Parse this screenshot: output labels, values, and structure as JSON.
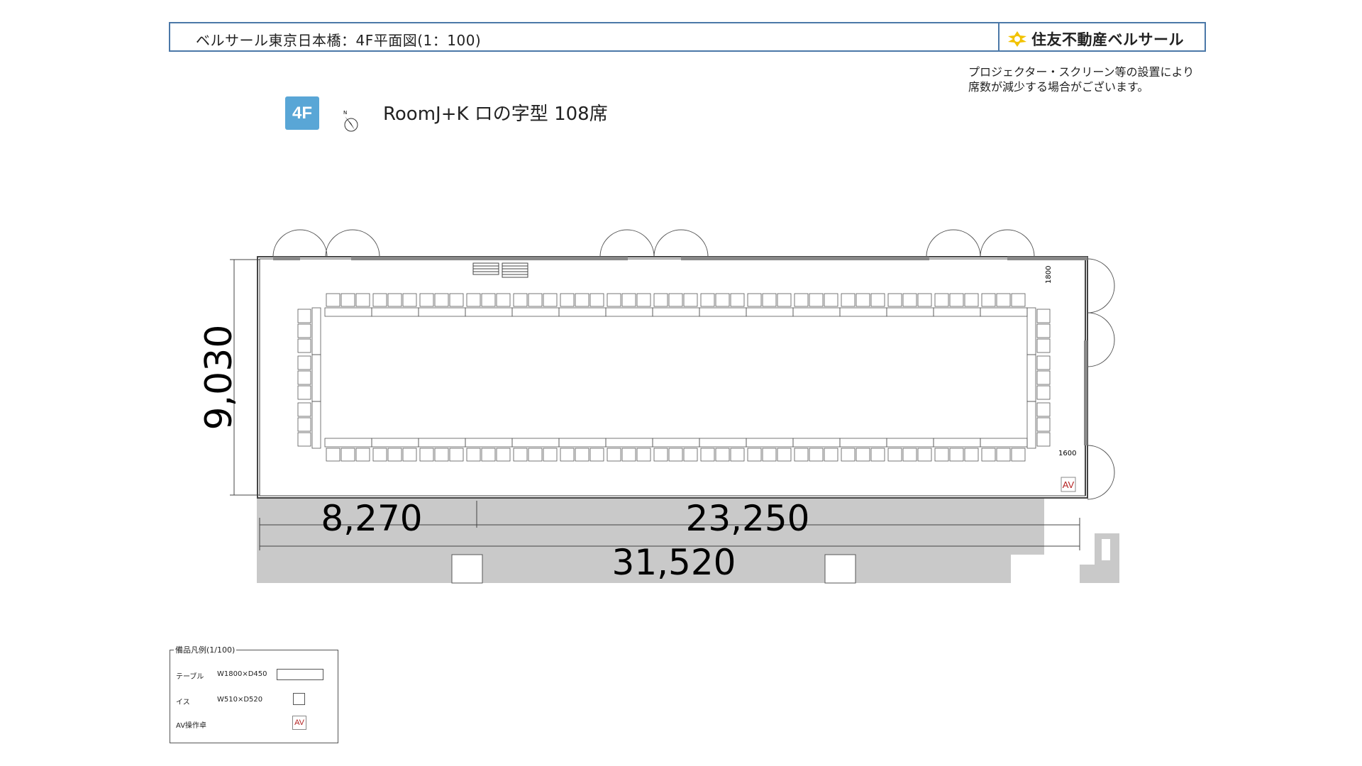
{
  "header": {
    "title": "ベルサール東京日本橋：4F平面図(1：100)",
    "brand": "住友不動産ベルサール"
  },
  "notice": {
    "line1": "プロジェクター・スクリーン等の設置により",
    "line2": "席数が減少する場合がございます。"
  },
  "floor_badge": "4F",
  "compass_label": "N",
  "room_title": "RoomJ+K ロの字型 108席",
  "dimensions": {
    "height_total": "9,030",
    "width_left": "8,270",
    "width_right": "23,250",
    "width_total": "31,520",
    "clearance_top": "1800",
    "clearance_right": "1600"
  },
  "av_label": "AV",
  "layout": {
    "top_tables": 15,
    "bottom_tables": 15,
    "side_tables": 3,
    "seats": 108
  },
  "legend": {
    "title": "備品凡例(1/100)",
    "table_label": "テーブル",
    "table_size": "W1800×D450",
    "chair_label": "イス",
    "chair_size": "W510×D520",
    "av_desk_label": "AV操作卓",
    "av_swatch": "AV"
  },
  "colors": {
    "frame": "#4b78a8",
    "badge": "#59a6d6",
    "corridor": "#c9c9c9",
    "av": "#b21f1f"
  }
}
